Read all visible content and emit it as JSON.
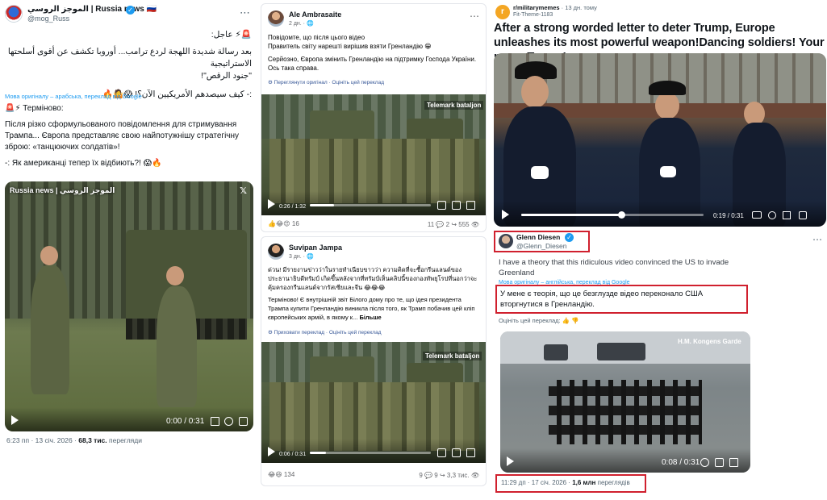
{
  "x_post": {
    "display_name": "الموجز الروسي | Russia news 🇷🇺",
    "handle": "@mog_Russ",
    "arabic_line1": "🚨⚡ عاجل:",
    "arabic_line2": "بعد رسالة شديدة اللهجة لردع ترامب... أوروبا تكشف عن أقوى أسلحتها الاستراتيجية",
    "arabic_line3": "\"جنود الرقص\"!",
    "arabic_line4": ":- كيف سيصدهم الأمريكيين الآن؟! 😱🤷🔥",
    "translate_note": "Мова оригіналу – арабська, переклад від Google",
    "ua_line1": "🚨⚡ Терміново:",
    "ua_line2": "Після різко сформульованого повідомлення для стримування Трампа... Європа представляє свою найпотужнішу стратегічну зброю: «танцюючих солдатів»!",
    "ua_line3": "-: Як американці тепер їх відбиють?! 😱🔥",
    "video_watermark": "Russia news | الموجز الروسي",
    "video_time": "0:00 / 0:31",
    "timestamp": "6:23 пп · 13 січ. 2026 ·",
    "views_count": "68,3 тис.",
    "views_label": "перегляди"
  },
  "fb_post_1": {
    "author": "Ale Ambrasaite",
    "meta": "2 дн. · 🌐",
    "line1": "Повідомте, що після цього відео",
    "line2": "Правитель світу нарешті вирішив взяти Гренландію 😁",
    "line3": "Серйозно, Європа змінить Гренландію на підтримку Господа України.",
    "line4": "Ось така справа.",
    "see_original": "Переглянути оригінал · Оцініть цей переклад",
    "watermark": "Telemark bataljon",
    "time": "0:26 / 1:32",
    "reactions": "16",
    "comments": "11",
    "shares": "2",
    "views": "555"
  },
  "fb_post_2": {
    "author": "Suvipan Jampa",
    "meta": "3 дн. · 🌐",
    "thai_text": "ด่วน! มีรายงานข่าวว่าในรายทำเนียบขาวว่า ความคิดที่จะซื้อกรีนแลนด์ของประธานาธิบดีทรัมป์ เกิดขึ้นหลังจากที่ทรัมป์เห็นคลิปนี้ของกองทัพยุโรปที่นอกว่าจะคุ้มครองกรีนแลนด์จากรัสเซียและจีน 😂😂😂",
    "ua_text": "Терміново! Є внутрішній звіт Білого дому про те, що ідея президента Трампа купити Гренландію виникла після того, як Трамп побачив цей кліп європейських армій, в якому к...",
    "more": "Більше",
    "hide_translation": "Приховати переклад · Оцініть цей переклад",
    "watermark": "Telemark bataljon",
    "time": "0:06 / 0:31",
    "reactions": "134",
    "comments": "9",
    "shares": "9",
    "views": "3,3 тис."
  },
  "reddit_post": {
    "subreddit": "r/militarymemes",
    "age": "· 13 дн. тому",
    "user": "Fit-Theme-1183",
    "title": "After a strong worded letter to deter Trump, Europe unleashes its most powerful weapon!Dancing soldiers! Your move Trump!",
    "time": "0:19 / 0:31",
    "progress": 0.55
  },
  "x_post_2": {
    "display_name": "Glenn Diesen",
    "handle": "@Glenn_Diesen",
    "text_en": "I have a theory that this ridiculous video convinced the US to invade Greenland",
    "translate_note": "Мова оригіналу – англійська, переклад від Google",
    "text_ua": "У мене є теорія, що це безглузде відео переконало США вторгнутися в Гренландію.",
    "rate": "Оцініть цей переклад:",
    "watermark": "H.M. Kongens Garde",
    "time": "0:08 / 0:31",
    "timestamp": "11:29 дп · 17 січ. 2026 ·",
    "views_count": "1,6 млн",
    "views_label": "переглядів"
  },
  "colors": {
    "x_blue": "#1d9bf0",
    "highlight_red": "#d0202e",
    "fb_link": "#385898",
    "reddit_orange": "#ff4500"
  }
}
